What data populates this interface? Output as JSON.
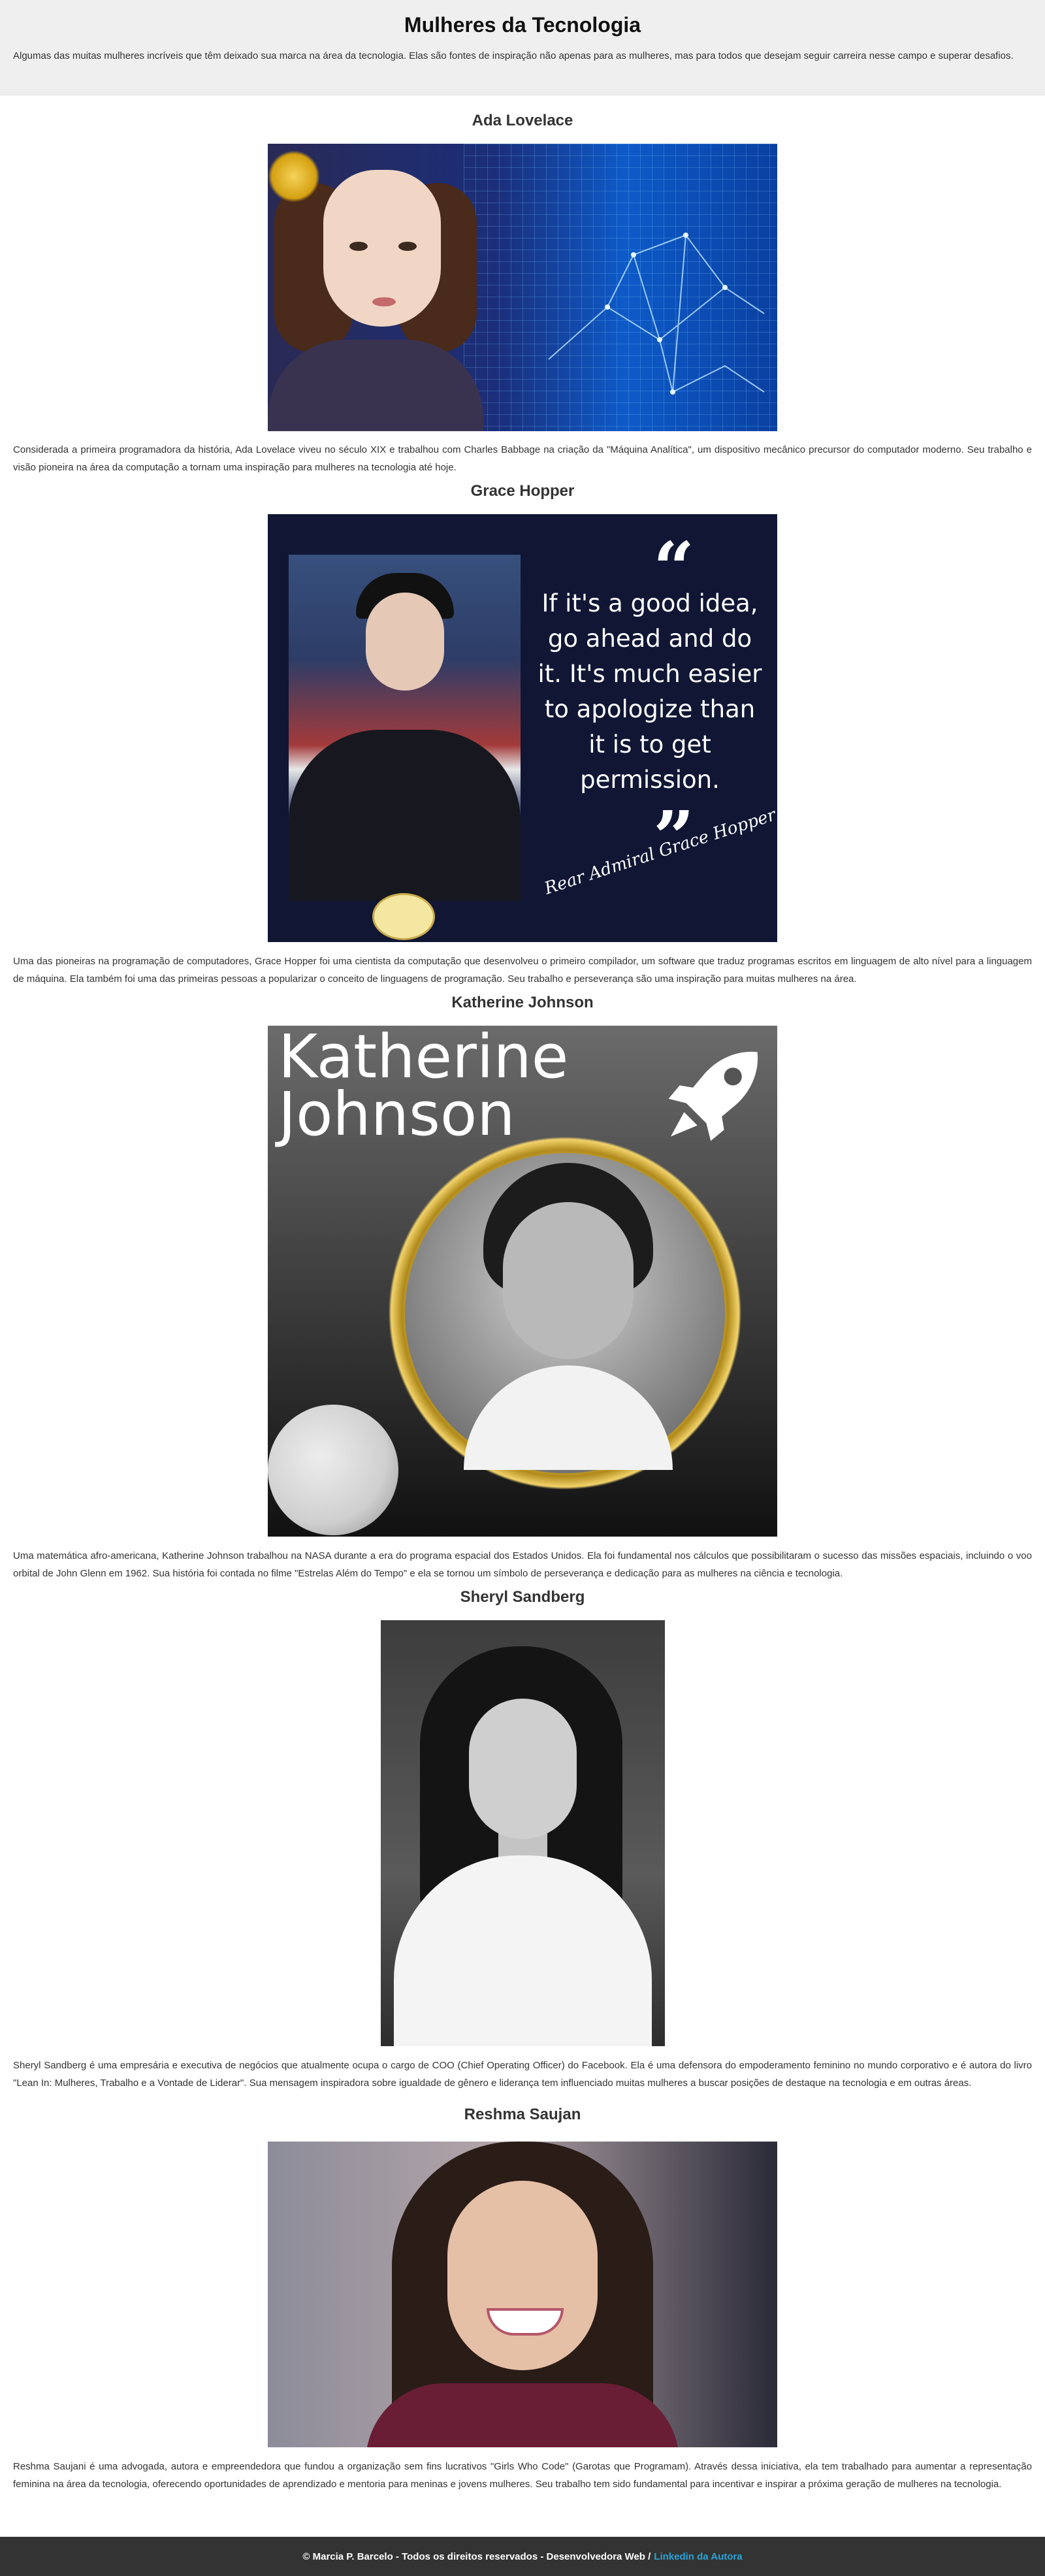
{
  "header": {
    "title": "Mulheres da Tecnologia",
    "intro": "Algumas das muitas mulheres incríveis que têm deixado sua marca na área da tecnologia. Elas são fontes de inspiração não apenas para as mulheres, mas para todos que desejam seguir carreira nesse campo e superar desafios."
  },
  "profiles": [
    {
      "name": "Ada Lovelace",
      "description": "Considerada a primeira programadora da história, Ada Lovelace viveu no século XIX e trabalhou com Charles Babbage na criação da \"Máquina Analítica\", um dispositivo mecânico precursor do computador moderno. Seu trabalho e visão pioneira na área da computação a tornam uma inspiração para mulheres na tecnologia até hoje."
    },
    {
      "name": "Grace Hopper",
      "description": "Uma das pioneiras na programação de computadores, Grace Hopper foi uma cientista da computação que desenvolveu o primeiro compilador, um software que traduz programas escritos em linguagem de alto nível para a linguagem de máquina. Ela também foi uma das primeiras pessoas a popularizar o conceito de linguagens de programação. Seu trabalho e perseverança são uma inspiração para muitas mulheres na área.",
      "image_quote": "If it's a good idea, go ahead and do it. It's much easier to apologize than it is to get permission.",
      "image_signature": "Rear Admiral Grace Hopper"
    },
    {
      "name": "Katherine Johnson",
      "description": "Uma matemática afro-americana, Katherine Johnson trabalhou na NASA durante a era do programa espacial dos Estados Unidos. Ela foi fundamental nos cálculos que possibilitaram o sucesso das missões espaciais, incluindo o voo orbital de John Glenn em 1962. Sua história foi contada no filme \"Estrelas Além do Tempo\" e ela se tornou um símbolo de perseverança e dedicação para as mulheres na ciência e tecnologia.",
      "image_title_line1": "Katherine",
      "image_title_line2": "Johnson"
    },
    {
      "name": "Sheryl Sandberg",
      "description": "Sheryl Sandberg é uma empresária e executiva de negócios que atualmente ocupa o cargo de COO (Chief Operating Officer) do Facebook. Ela é uma defensora do empoderamento feminino no mundo corporativo e é autora do livro \"Lean In: Mulheres, Trabalho e a Vontade de Liderar\". Sua mensagem inspiradora sobre igualdade de gênero e liderança tem influenciado muitas mulheres a buscar posições de destaque na tecnologia e em outras áreas."
    },
    {
      "name": "Reshma Saujan",
      "description": "Reshma Saujani é uma advogada, autora e empreendedora que fundou a organização sem fins lucrativos \"Girls Who Code\" (Garotas que Programam). Através dessa iniciativa, ela tem trabalhado para aumentar a representação feminina na área da tecnologia, oferecendo oportunidades de aprendizado e mentoria para meninas e jovens mulheres. Seu trabalho tem sido fundamental para incentivar e inspirar a próxima geração de mulheres na tecnologia."
    }
  ],
  "footer": {
    "text": "© Marcia P. Barcelo - Todos os direitos reservados - Desenvolvedora Web /",
    "link_label": "Linkedin da Autora",
    "link_color": "#29a3d6"
  }
}
